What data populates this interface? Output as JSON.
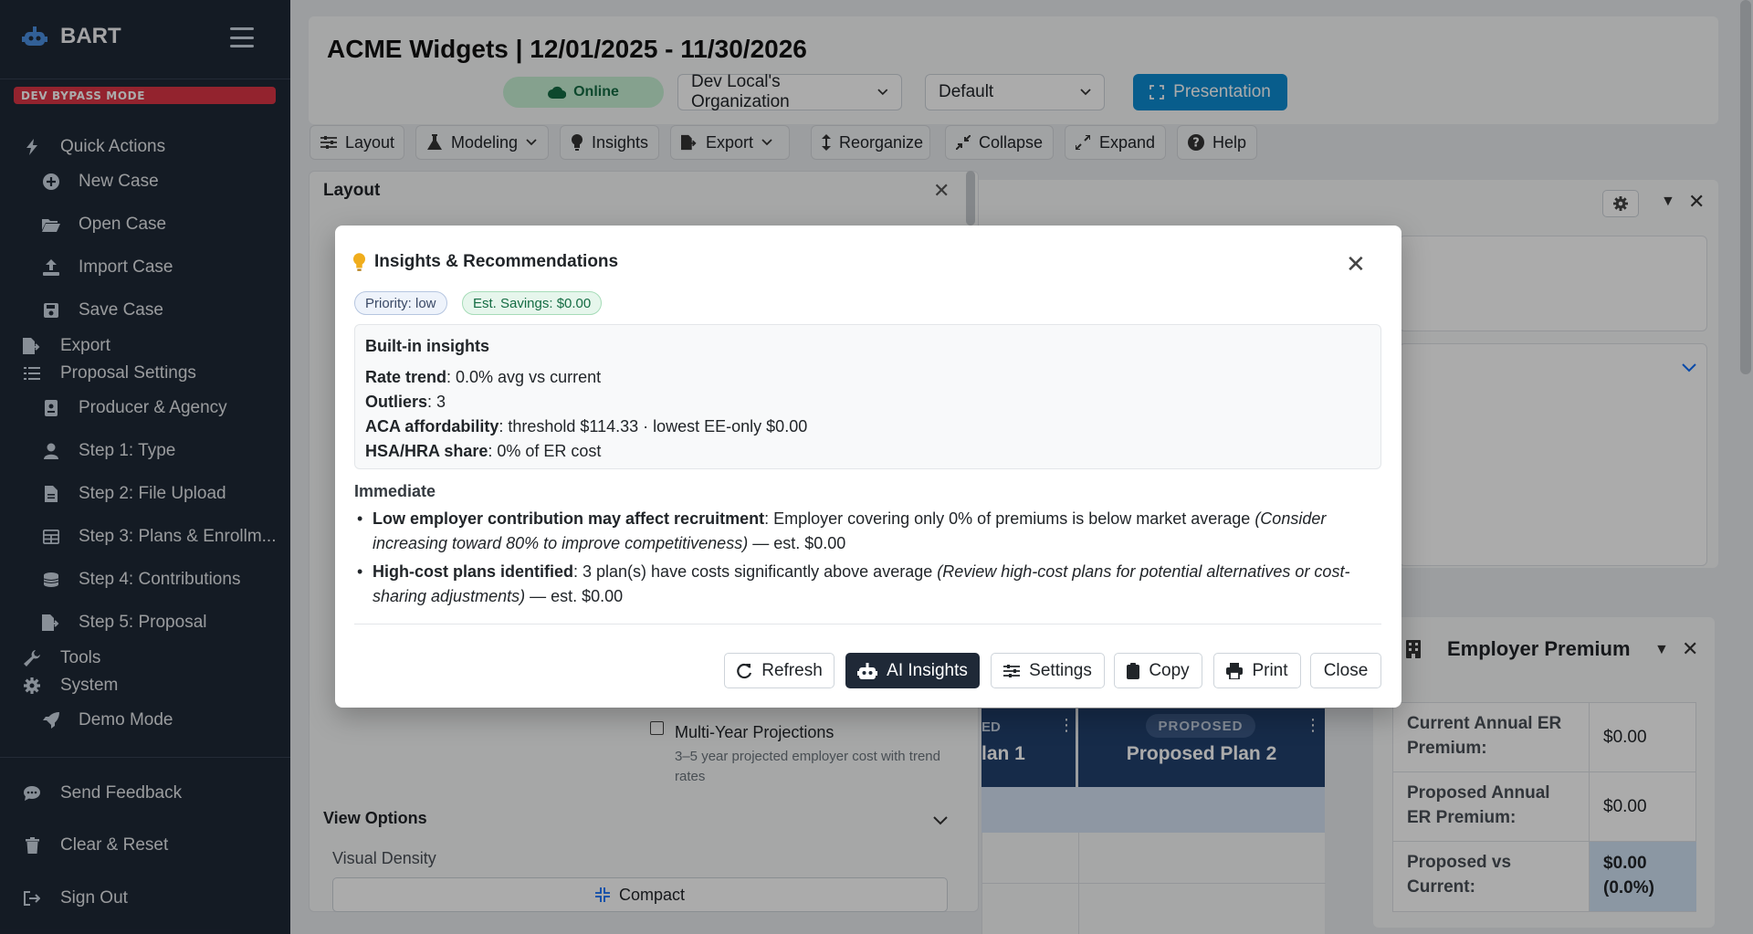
{
  "sidebar": {
    "brand": "BART",
    "dev_badge": "DEV BYPASS MODE",
    "quick_actions": "Quick Actions",
    "new_case": "New Case",
    "open_case": "Open Case",
    "import_case": "Import Case",
    "save_case": "Save Case",
    "export": "Export",
    "proposal_settings": "Proposal Settings",
    "producer_agency": "Producer & Agency",
    "step1": "Step 1: Type",
    "step2": "Step 2: File Upload",
    "step3": "Step 3: Plans & Enrollm...",
    "step4": "Step 4: Contributions",
    "step5": "Step 5: Proposal",
    "tools": "Tools",
    "system": "System",
    "demo_mode": "Demo Mode",
    "send_feedback": "Send Feedback",
    "clear_reset": "Clear & Reset",
    "sign_out": "Sign Out"
  },
  "header": {
    "title": "ACME Widgets | 12/01/2025 - 11/30/2026",
    "status": "Online",
    "org_select": "Dev Local's Organization",
    "view_select": "Default",
    "presentation": "Presentation"
  },
  "toolbar": {
    "layout": "Layout",
    "modeling": "Modeling",
    "insights": "Insights",
    "export": "Export",
    "reorganize": "Reorganize",
    "collapse": "Collapse",
    "expand": "Expand",
    "help": "Help"
  },
  "layout_panel": {
    "title": "Layout",
    "multi_year_title": "Multi-Year Projections",
    "multi_year_desc": "3–5 year projected employer cost with trend rates",
    "view_options": "View Options",
    "visual_density": "Visual Density",
    "compact": "Compact"
  },
  "plans": {
    "plan1_label": "ED",
    "plan1_name": "lan 1",
    "plan2_badge": "PROPOSED",
    "plan2_name": "Proposed Plan 2"
  },
  "employer_premium": {
    "title": "Employer Premium",
    "rows": [
      {
        "label": "Current Annual ER Premium:",
        "value": "$0.00"
      },
      {
        "label": "Proposed Annual ER Premium:",
        "value": "$0.00"
      },
      {
        "label": "Proposed vs Current:",
        "value": "$0.00 (0.0%)"
      }
    ]
  },
  "modal": {
    "title": "Insights & Recommendations",
    "priority": "Priority: low",
    "savings": "Est. Savings: $0.00",
    "builtin_header": "Built-in insights",
    "rate_trend_k": "Rate trend",
    "rate_trend_v": ": 0.0% avg vs current",
    "outliers_k": "Outliers",
    "outliers_v": ": 3",
    "aca_k": "ACA affordability",
    "aca_v": ": threshold $114.33 · lowest EE-only $0.00",
    "hsa_k": "HSA/HRA share",
    "hsa_v": ": 0% of ER cost",
    "immediate": "Immediate",
    "item1_k": "Low employer contribution may affect recruitment",
    "item1_v": ": Employer covering only 0% of premiums is below market average ",
    "item1_i": "(Consider increasing toward 80% to improve competitiveness)",
    "item1_e": " — est. $0.00",
    "item2_k": "High-cost plans identified",
    "item2_v": ": 3 plan(s) have costs significantly above average ",
    "item2_i": "(Review high-cost plans for potential alternatives or cost-sharing adjustments)",
    "item2_e": " — est. $0.00",
    "buttons": {
      "refresh": "Refresh",
      "ai_insights": "AI Insights",
      "settings": "Settings",
      "copy": "Copy",
      "print": "Print",
      "close": "Close"
    }
  },
  "colors": {
    "sidebar_bg": "#1f2937",
    "accent": "#0d8bd1",
    "danger": "#dc3545",
    "plan_header": "#21416d"
  }
}
